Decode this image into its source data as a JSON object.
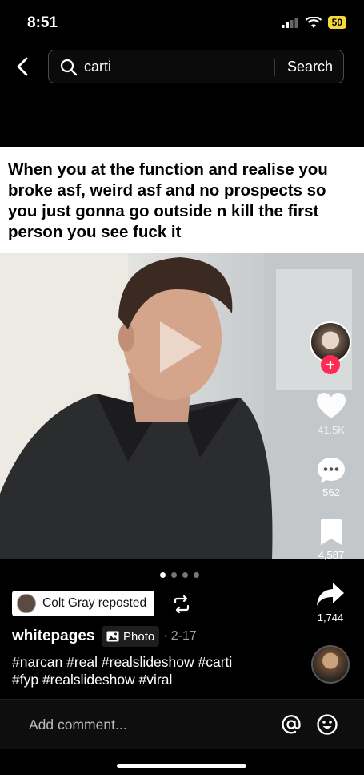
{
  "status": {
    "time": "8:51",
    "battery": "50"
  },
  "search": {
    "query": "carti",
    "button": "Search"
  },
  "post": {
    "caption": "When you at the function and realise you broke asf, weird asf and no prospects so you just gonna go outside n kill the first person you see fuck it"
  },
  "rail": {
    "likes": "41.5K",
    "comments": "562",
    "saves": "4,587",
    "shares": "1,744"
  },
  "carousel": {
    "total": 4,
    "active_index": 0
  },
  "meta": {
    "repost_label": "Colt Gray reposted",
    "author": "whitepages",
    "photo_tag": "Photo",
    "date": "· 2-17",
    "hashtags_line1": "#narcan #real #realslideshow #carti",
    "hashtags_line2": "#fyp #realslideshow #viral"
  },
  "comment": {
    "placeholder": "Add comment..."
  },
  "colors": {
    "like_red": "#fe2c55",
    "battery": "#f5d93a"
  }
}
